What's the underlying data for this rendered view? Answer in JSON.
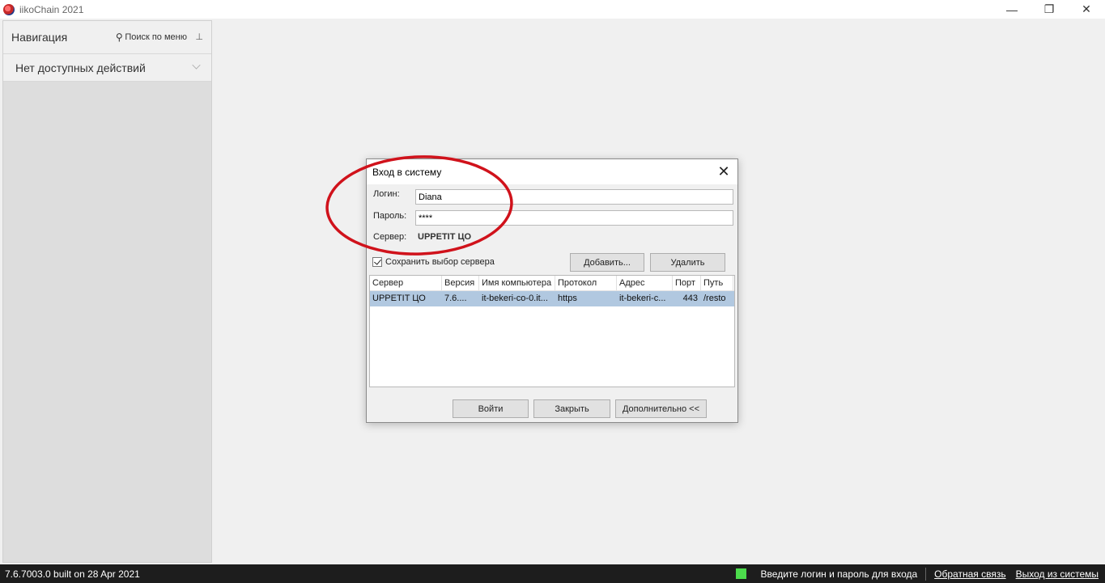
{
  "window": {
    "title": "iikoChain 2021",
    "minimize": "—",
    "restore": "❐",
    "close": "✕"
  },
  "nav": {
    "title": "Навигация",
    "search_label": "Поиск по меню",
    "search_glyph": "⚲",
    "pin_glyph": "⊥",
    "section_label": "Нет доступных действий"
  },
  "dialog": {
    "title": "Вход в систему",
    "close": "✕",
    "login_label": "Логин:",
    "login_value": "Diana",
    "password_label": "Пароль:",
    "password_value": "****",
    "server_label": "Сервер:",
    "server_value": "UPPETIT ЦО",
    "save_server_label": "Сохранить выбор сервера",
    "add_button": "Добавить...",
    "delete_button": "Удалить",
    "table": {
      "columns": [
        "Сервер",
        "Версия",
        "Имя компьютера",
        "Протокол",
        "Адрес",
        "Порт",
        "Путь"
      ],
      "rows": [
        [
          "UPPETIT ЦО",
          "7.6....",
          "it-bekeri-co-0.it...",
          "https",
          "it-bekeri-c...",
          "443",
          "/resto"
        ]
      ]
    },
    "login_button": "Войти",
    "cancel_button": "Закрыть",
    "more_button": "Дополнительно <<"
  },
  "statusbar": {
    "version": "7.6.7003.0 built on 28 Apr 2021",
    "status_text": "Введите логин и пароль для входа",
    "feedback_link": "Обратная связь",
    "exit_link": "Выход из системы",
    "indicator_color": "#4cdc4c"
  },
  "annotation": {
    "color": "#d0121b"
  }
}
